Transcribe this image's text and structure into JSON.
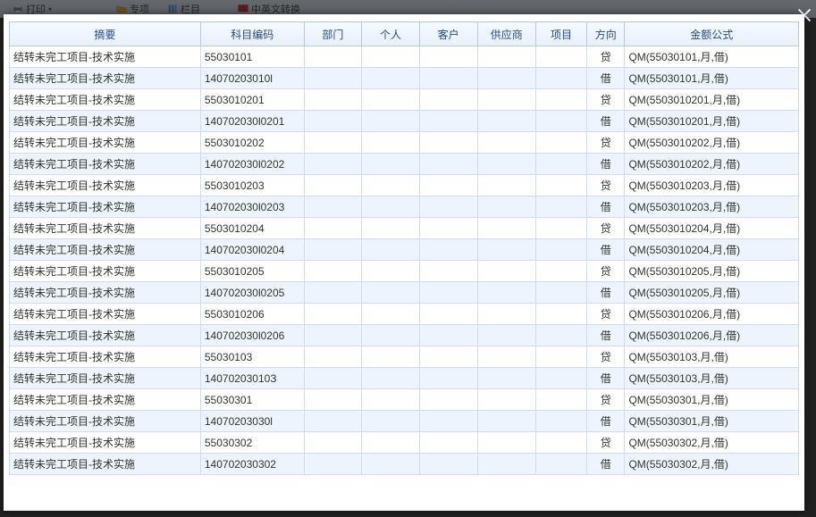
{
  "ghost_toolbar": {
    "print": "打印",
    "special": "专项",
    "column": "栏目",
    "convert": "中英文转换"
  },
  "grid": {
    "headers": {
      "summary": "摘要",
      "code": "科目编码",
      "dept": "部门",
      "person": "个人",
      "customer": "客户",
      "supplier": "供应商",
      "project": "项目",
      "dir": "方向",
      "formula": "金额公式"
    },
    "rows": [
      {
        "summary": "结转未完工项目-技术实施",
        "code": "55030101",
        "dept": "",
        "person": "",
        "customer": "",
        "supplier": "",
        "project": "",
        "dir": "贷",
        "formula": "QM(55030101,月,借)"
      },
      {
        "summary": "结转未完工项目-技术实施",
        "code": "14070203010l",
        "dept": "",
        "person": "",
        "customer": "",
        "supplier": "",
        "project": "",
        "dir": "借",
        "formula": "QM(55030101,月,借)"
      },
      {
        "summary": "结转未完工项目-技术实施",
        "code": "5503010201",
        "dept": "",
        "person": "",
        "customer": "",
        "supplier": "",
        "project": "",
        "dir": "贷",
        "formula": "QM(5503010201,月,借)"
      },
      {
        "summary": "结转未完工项目-技术实施",
        "code": "140702030l0201",
        "dept": "",
        "person": "",
        "customer": "",
        "supplier": "",
        "project": "",
        "dir": "借",
        "formula": "QM(5503010201,月,借)"
      },
      {
        "summary": "结转未完工项目-技术实施",
        "code": "5503010202",
        "dept": "",
        "person": "",
        "customer": "",
        "supplier": "",
        "project": "",
        "dir": "贷",
        "formula": "QM(5503010202,月,借)"
      },
      {
        "summary": "结转未完工项目-技术实施",
        "code": "140702030l0202",
        "dept": "",
        "person": "",
        "customer": "",
        "supplier": "",
        "project": "",
        "dir": "借",
        "formula": "QM(5503010202,月,借)"
      },
      {
        "summary": "结转未完工项目-技术实施",
        "code": "5503010203",
        "dept": "",
        "person": "",
        "customer": "",
        "supplier": "",
        "project": "",
        "dir": "贷",
        "formula": "QM(5503010203,月,借)"
      },
      {
        "summary": "结转未完工项目-技术实施",
        "code": "140702030l0203",
        "dept": "",
        "person": "",
        "customer": "",
        "supplier": "",
        "project": "",
        "dir": "借",
        "formula": "QM(5503010203,月,借)"
      },
      {
        "summary": "结转未完工项目-技术实施",
        "code": "5503010204",
        "dept": "",
        "person": "",
        "customer": "",
        "supplier": "",
        "project": "",
        "dir": "贷",
        "formula": "QM(5503010204,月,借)"
      },
      {
        "summary": "结转未完工项目-技术实施",
        "code": "140702030l0204",
        "dept": "",
        "person": "",
        "customer": "",
        "supplier": "",
        "project": "",
        "dir": "借",
        "formula": "QM(5503010204,月,借)"
      },
      {
        "summary": "结转未完工项目-技术实施",
        "code": "5503010205",
        "dept": "",
        "person": "",
        "customer": "",
        "supplier": "",
        "project": "",
        "dir": "贷",
        "formula": "QM(5503010205,月,借)"
      },
      {
        "summary": "结转未完工项目-技术实施",
        "code": "140702030l0205",
        "dept": "",
        "person": "",
        "customer": "",
        "supplier": "",
        "project": "",
        "dir": "借",
        "formula": "QM(5503010205,月,借)"
      },
      {
        "summary": "结转未完工项目-技术实施",
        "code": "5503010206",
        "dept": "",
        "person": "",
        "customer": "",
        "supplier": "",
        "project": "",
        "dir": "贷",
        "formula": "QM(5503010206,月,借)"
      },
      {
        "summary": "结转未完工项目-技术实施",
        "code": "140702030l0206",
        "dept": "",
        "person": "",
        "customer": "",
        "supplier": "",
        "project": "",
        "dir": "借",
        "formula": "QM(5503010206,月,借)"
      },
      {
        "summary": "结转未完工项目-技术实施",
        "code": "55030103",
        "dept": "",
        "person": "",
        "customer": "",
        "supplier": "",
        "project": "",
        "dir": "贷",
        "formula": "QM(55030103,月,借)"
      },
      {
        "summary": "结转未完工项目-技术实施",
        "code": "14070203010З",
        "dept": "",
        "person": "",
        "customer": "",
        "supplier": "",
        "project": "",
        "dir": "借",
        "formula": "QM(55030103,月,借)"
      },
      {
        "summary": "结转未完工项目-技术实施",
        "code": "55030301",
        "dept": "",
        "person": "",
        "customer": "",
        "supplier": "",
        "project": "",
        "dir": "贷",
        "formula": "QM(55030301,月,借)"
      },
      {
        "summary": "结转未完工项目-技术实施",
        "code": "14070203030l",
        "dept": "",
        "person": "",
        "customer": "",
        "supplier": "",
        "project": "",
        "dir": "借",
        "formula": "QM(55030301,月,借)"
      },
      {
        "summary": "结转未完工项目-技术实施",
        "code": "55030302",
        "dept": "",
        "person": "",
        "customer": "",
        "supplier": "",
        "project": "",
        "dir": "贷",
        "formula": "QM(55030302,月,借)"
      },
      {
        "summary": "结转未完工项目-技术实施",
        "code": "140702030302",
        "dept": "",
        "person": "",
        "customer": "",
        "supplier": "",
        "project": "",
        "dir": "借",
        "formula": "QM(55030302,月,借)"
      }
    ]
  }
}
